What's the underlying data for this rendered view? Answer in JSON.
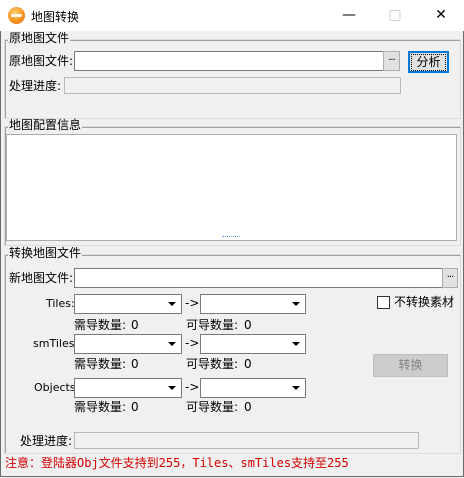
{
  "window": {
    "title": "地图转换",
    "minimize_glyph": "—",
    "maximize_glyph": "□",
    "close_glyph": "✕"
  },
  "source_group": {
    "title": "原地图文件",
    "file_label": "原地图文件:",
    "file_value": "",
    "browse_label": "···",
    "analyze_label": "分析",
    "progress_label": "处理进度:"
  },
  "config_group": {
    "title": "地图配置信息",
    "content": ""
  },
  "convert_group": {
    "title": "转换地图文件",
    "new_file_label": "新地图文件:",
    "new_file_value": "",
    "browse_label": "···",
    "rows": [
      {
        "label": "Tiles:",
        "arrow": "->",
        "need_label": "需导数量:",
        "need_value": "0",
        "can_label": "可导数量:",
        "can_value": "0"
      },
      {
        "label": "smTiles:",
        "arrow": "->",
        "need_label": "需导数量:",
        "need_value": "0",
        "can_label": "可导数量:",
        "can_value": "0"
      },
      {
        "label": "Objects:",
        "arrow": "->",
        "need_label": "需导数量:",
        "need_value": "0",
        "can_label": "可导数量:",
        "can_value": "0"
      }
    ],
    "no_convert_label": "不转换素材",
    "convert_label": "转换",
    "progress_label": "处理进度:"
  },
  "notice": "注意：登陆器Obj文件支持到255，Tiles、smTiles支持至255"
}
